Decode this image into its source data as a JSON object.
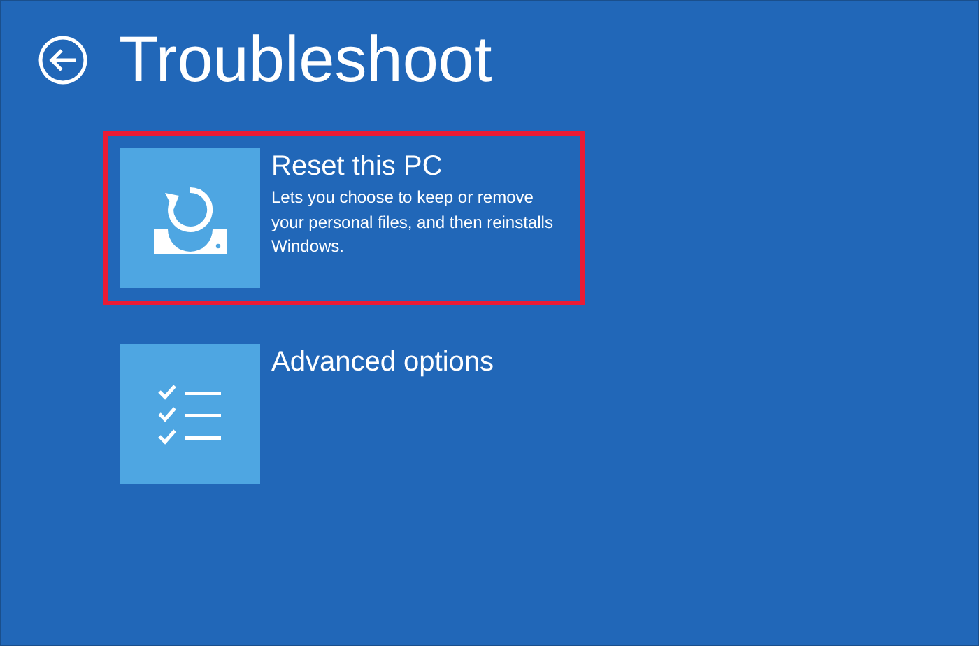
{
  "title": "Troubleshoot",
  "options": [
    {
      "kind": "reset",
      "label": "Reset this PC",
      "description": "Lets you choose to keep or remove your personal files, and then reinstalls Windows.",
      "highlighted": true
    },
    {
      "kind": "advanced",
      "label": "Advanced options",
      "highlighted": false
    }
  ]
}
